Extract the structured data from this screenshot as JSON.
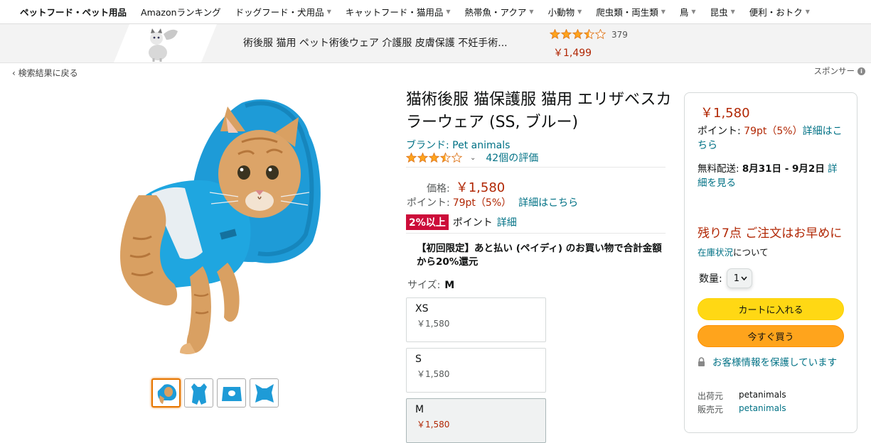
{
  "nav": {
    "items": [
      {
        "label": "ペットフード・ペット用品",
        "caret": false
      },
      {
        "label": "Amazonランキング",
        "caret": false
      },
      {
        "label": "ドッグフード・犬用品",
        "caret": true
      },
      {
        "label": "キャットフード・猫用品",
        "caret": true
      },
      {
        "label": "熱帯魚・アクア",
        "caret": true
      },
      {
        "label": "小動物",
        "caret": true
      },
      {
        "label": "爬虫類・両生類",
        "caret": true
      },
      {
        "label": "鳥",
        "caret": true
      },
      {
        "label": "昆虫",
        "caret": true
      },
      {
        "label": "便利・おトク",
        "caret": true
      }
    ]
  },
  "banner": {
    "title": "術後服 猫用 ペット術後ウェア 介護服 皮膚保護 不妊手術...",
    "rating": 3.5,
    "rating_count": "379",
    "price": "￥1,499"
  },
  "back_link": "‹ 検索結果に戻る",
  "sponsor_label": "スポンサー",
  "product": {
    "title": "猫術後服 猫保護服 猫用 エリザベスカラーウェア (SS, ブルー)",
    "brand": "ブランド: Pet animals",
    "rating": 3.5,
    "rating_count": "42個の評価",
    "price_label": "価格:",
    "price": "￥1,580",
    "points_label": "ポイント:",
    "points": "79pt（5%）",
    "points_link": "詳細はこちら",
    "badge": "2%以上",
    "badge_text": "ポイント",
    "badge_link": "詳細",
    "promo": "【初回限定】あと払い (ペイディ) のお買い物で合計金額から20%還元",
    "size_label": "サイズ:",
    "size_selected": "M",
    "sizes": [
      {
        "name": "XS",
        "price": "￥1,580"
      },
      {
        "name": "S",
        "price": "￥1,580"
      },
      {
        "name": "M",
        "price": "￥1,580"
      }
    ]
  },
  "buybox": {
    "price": "￥1,580",
    "points_label": "ポイント: ",
    "points": "79pt（5%）",
    "points_link": "詳細はこちら",
    "delivery_label": "無料配送: ",
    "delivery_date": "8月31日 - 9月2日",
    "delivery_link": "詳細を見る",
    "stock": "残り7点 ご注文はお早めに",
    "stock_link": "在庫状況",
    "stock_suffix": "について",
    "qty_label": "数量:",
    "qty_value": "1",
    "add_to_cart": "カートに入れる",
    "buy_now": "今すぐ買う",
    "secure": "お客様情報を保護しています",
    "shipper_label": "出荷元",
    "shipper": "petanimals",
    "seller_label": "販売元",
    "seller": "petanimals"
  },
  "colors": {
    "price": "#b12704",
    "link": "#007185",
    "cart_button": "#ffd814",
    "buy_button": "#ffa41c",
    "badge": "#cc0c39",
    "product_blue": "#1e9bd7",
    "cat_orange": "#d9a062"
  }
}
